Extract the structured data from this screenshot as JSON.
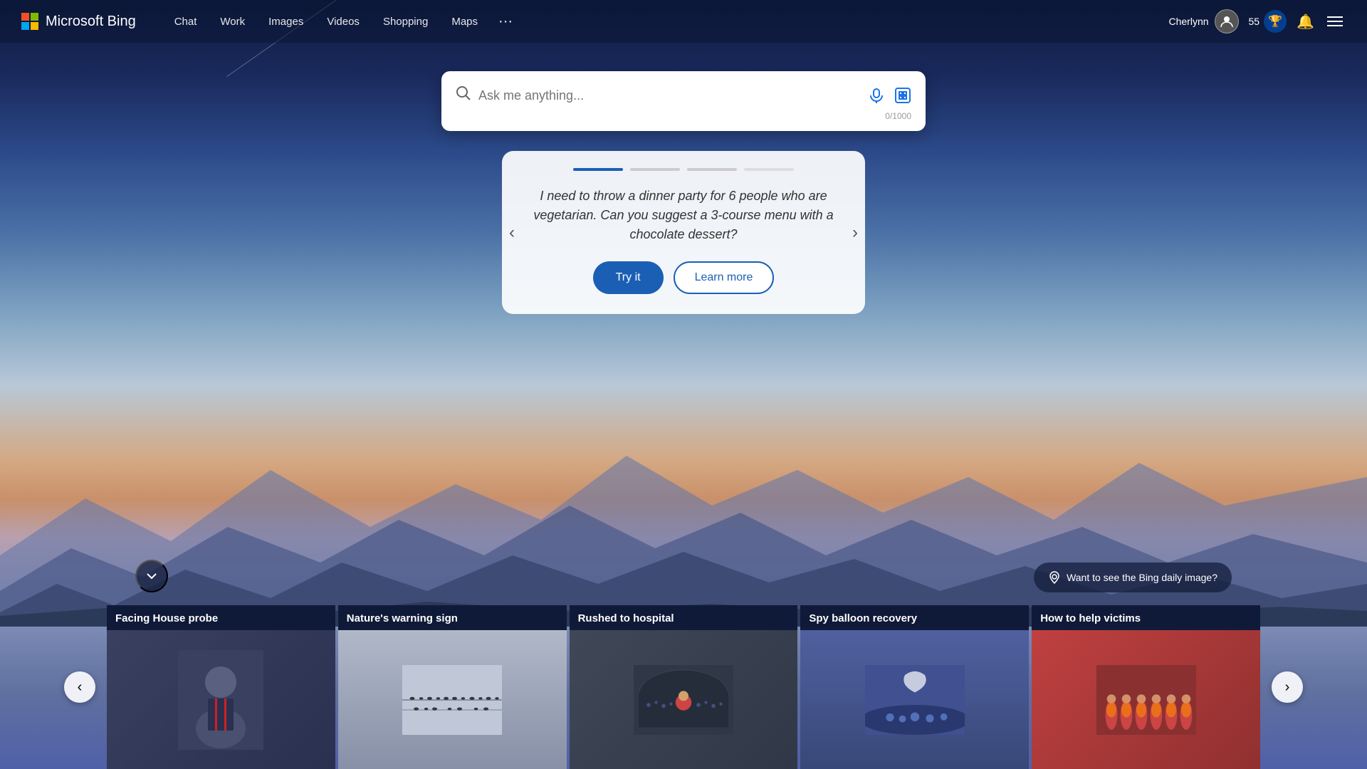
{
  "brand": {
    "logo_text": "Microsoft Bing"
  },
  "nav": {
    "links": [
      {
        "label": "Chat",
        "id": "chat"
      },
      {
        "label": "Work",
        "id": "work"
      },
      {
        "label": "Images",
        "id": "images"
      },
      {
        "label": "Videos",
        "id": "videos"
      },
      {
        "label": "Shopping",
        "id": "shopping"
      },
      {
        "label": "Maps",
        "id": "maps"
      },
      {
        "label": "···",
        "id": "more"
      }
    ],
    "user_name": "Cherlynn",
    "score": "55",
    "daily_image_label": "Want to see the Bing daily image?"
  },
  "search": {
    "placeholder": "Ask me anything...",
    "char_count": "0/1000"
  },
  "suggestion": {
    "text": "I need to throw a dinner party for 6 people who are vegetarian. Can you suggest a 3-course menu with a chocolate dessert?",
    "try_label": "Try it",
    "learn_label": "Learn more"
  },
  "news_cards": [
    {
      "title": "Facing House probe",
      "img_type": "person"
    },
    {
      "title": "Nature's warning sign",
      "img_type": "birds"
    },
    {
      "title": "Rushed to hospital",
      "img_type": "stadium"
    },
    {
      "title": "Spy balloon recovery",
      "img_type": "balloon"
    },
    {
      "title": "How to help victims",
      "img_type": "rescue"
    }
  ],
  "scroll_down_label": "↓"
}
